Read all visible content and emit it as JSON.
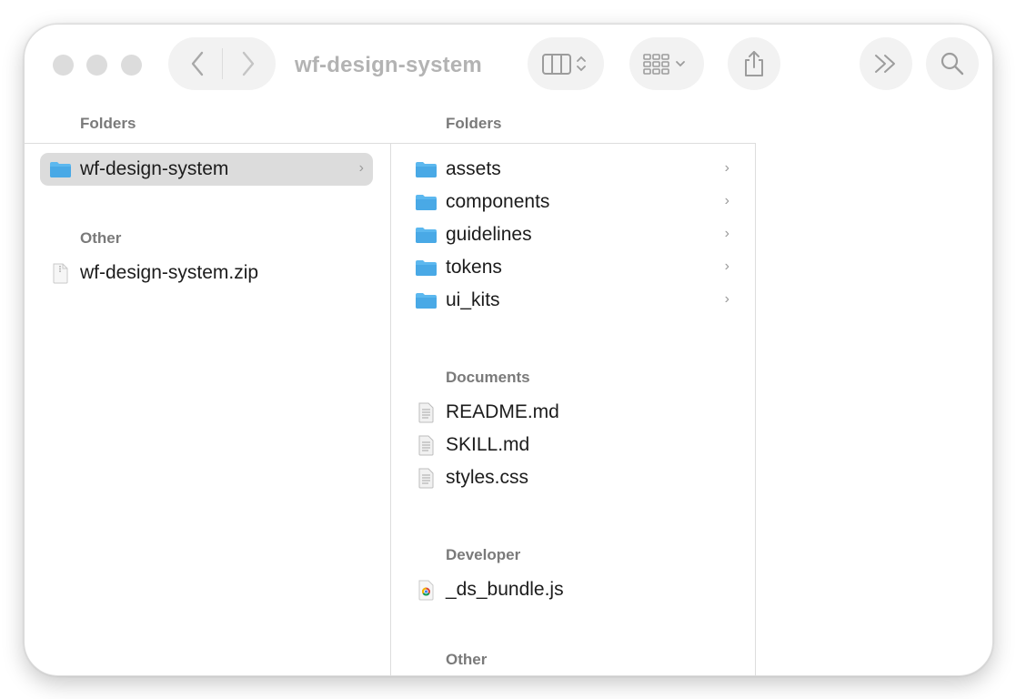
{
  "window": {
    "title": "wf-design-system"
  },
  "toolbar": {
    "back_icon": "chevron-left-icon",
    "forward_icon": "chevron-right-icon",
    "view_icon": "column-view-icon",
    "group_icon": "grid-view-icon",
    "share_icon": "share-icon",
    "more_icon": "double-chevron-icon",
    "search_icon": "search-icon"
  },
  "left_column": {
    "folders_header": "Folders",
    "folders": [
      {
        "label": "wf-design-system",
        "selected": true,
        "icon": "folder-icon"
      }
    ],
    "other_header": "Other",
    "other": [
      {
        "label": "wf-design-system.zip",
        "icon": "zip-file-icon"
      }
    ]
  },
  "right_column": {
    "folders_header": "Folders",
    "folders": [
      {
        "label": "assets"
      },
      {
        "label": "components"
      },
      {
        "label": "guidelines"
      },
      {
        "label": "tokens"
      },
      {
        "label": "ui_kits"
      }
    ],
    "documents_header": "Documents",
    "documents": [
      {
        "label": "README.md"
      },
      {
        "label": "SKILL.md"
      },
      {
        "label": "styles.css"
      }
    ],
    "developer_header": "Developer",
    "developer": [
      {
        "label": "_ds_bundle.js"
      }
    ],
    "other_header": "Other"
  },
  "colors": {
    "folder_blue": "#5cb8ef",
    "selection_gray": "#dcdcdc",
    "header_gray": "#7a7a7a"
  }
}
